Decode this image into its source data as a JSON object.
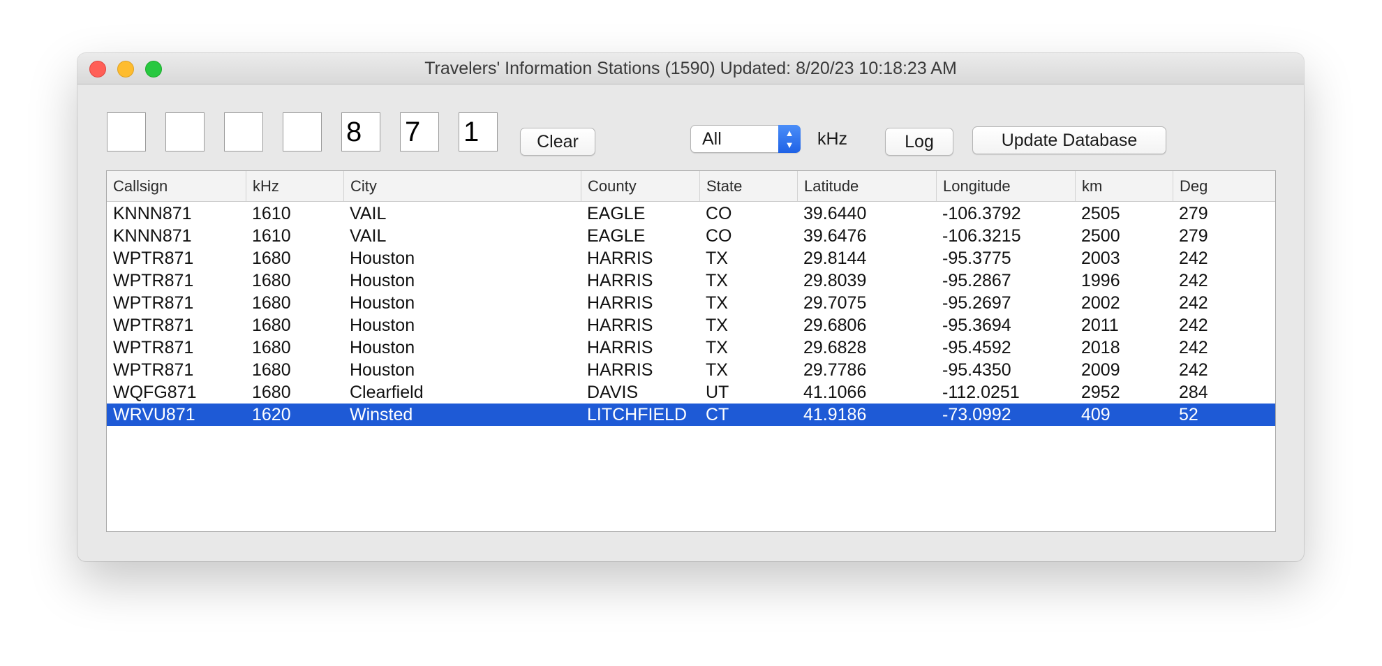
{
  "window": {
    "title": "Travelers' Information Stations (1590) Updated: 8/20/23 10:18:23 AM"
  },
  "digits": [
    "",
    "",
    "",
    "",
    "8",
    "7",
    "1"
  ],
  "toolbar": {
    "clear_label": "Clear",
    "band_select_value": "All",
    "khz_label": "kHz",
    "log_label": "Log",
    "update_label": "Update Database"
  },
  "table": {
    "columns": [
      "Callsign",
      "kHz",
      "City",
      "County",
      "State",
      "Latitude",
      "Longitude",
      "km",
      "Deg"
    ],
    "rows": [
      [
        "KNNN871",
        "1610",
        "VAIL",
        "EAGLE",
        "CO",
        "39.6440",
        "-106.3792",
        "2505",
        "279"
      ],
      [
        "KNNN871",
        "1610",
        "VAIL",
        "EAGLE",
        "CO",
        "39.6476",
        "-106.3215",
        "2500",
        "279"
      ],
      [
        "WPTR871",
        "1680",
        "Houston",
        "HARRIS",
        "TX",
        "29.8144",
        "-95.3775",
        "2003",
        "242"
      ],
      [
        "WPTR871",
        "1680",
        "Houston",
        "HARRIS",
        "TX",
        "29.8039",
        "-95.2867",
        "1996",
        "242"
      ],
      [
        "WPTR871",
        "1680",
        "Houston",
        "HARRIS",
        "TX",
        "29.7075",
        "-95.2697",
        "2002",
        "242"
      ],
      [
        "WPTR871",
        "1680",
        "Houston",
        "HARRIS",
        "TX",
        "29.6806",
        "-95.3694",
        "2011",
        "242"
      ],
      [
        "WPTR871",
        "1680",
        "Houston",
        "HARRIS",
        "TX",
        "29.6828",
        "-95.4592",
        "2018",
        "242"
      ],
      [
        "WPTR871",
        "1680",
        "Houston",
        "HARRIS",
        "TX",
        "29.7786",
        "-95.4350",
        "2009",
        "242"
      ],
      [
        "WQFG871",
        "1680",
        "Clearfield",
        "DAVIS",
        "UT",
        "41.1066",
        "-112.0251",
        "2952",
        "284"
      ],
      [
        "WRVU871",
        "1620",
        "Winsted",
        "LITCHFIELD",
        "CT",
        "41.9186",
        "-73.0992",
        "409",
        "52"
      ]
    ],
    "selected_row": 9
  },
  "colors": {
    "selection": "#1e5ad6",
    "close": "#ff5f57",
    "minimize": "#febc2e",
    "maximize": "#28c840",
    "select_accent": "#2f74f0"
  }
}
